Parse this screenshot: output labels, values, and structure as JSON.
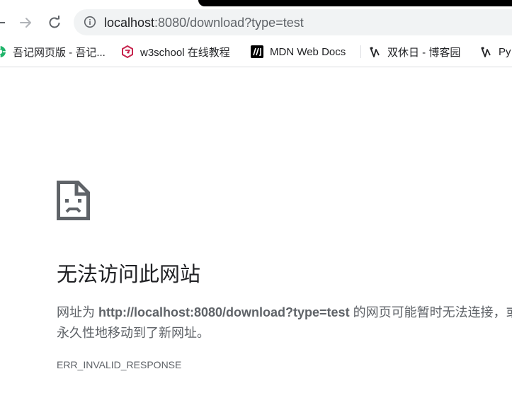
{
  "browser": {
    "address_bar": {
      "host": "localhost",
      "rest": ":8080/download?type=test"
    },
    "bookmarks": [
      {
        "label": "吾记网页版 - 吾记...",
        "icon": "wuji-icon"
      },
      {
        "label": "w3school 在线教程",
        "icon": "w3school-icon"
      },
      {
        "label": "MDN Web Docs",
        "icon": "mdn-icon"
      },
      {
        "label": "双休日 - 博客园",
        "icon": "cnblogs-icon"
      },
      {
        "label": "Py",
        "icon": "cnblogs-icon"
      }
    ]
  },
  "error_page": {
    "title": "无法访问此网站",
    "desc_prefix": "网址为 ",
    "desc_url": "http://localhost:8080/download?type=test",
    "desc_suffix_1": " 的网页可能暂时无法连接，或者它已",
    "desc_line_2": "永久性地移动到了新网址。",
    "error_code": "ERR_INVALID_RESPONSE"
  },
  "colors": {
    "text_primary": "#202124",
    "text_secondary": "#5f6368",
    "omnibox_bg": "#f1f3f4",
    "icon_gray": "#5f6368"
  }
}
